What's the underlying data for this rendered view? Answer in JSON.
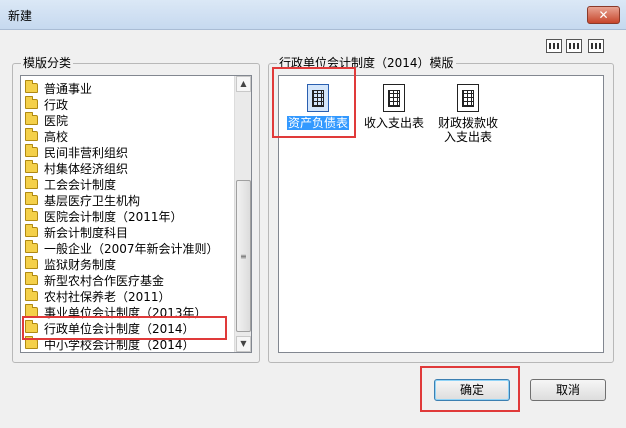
{
  "window": {
    "title": "新建",
    "close_label": "✕"
  },
  "left_group": {
    "label": "模版分类"
  },
  "right_group": {
    "label": "行政单位会计制度（2014）模版"
  },
  "categories": [
    "普通事业",
    "行政",
    "医院",
    "高校",
    "民间非营利组织",
    "村集体经济组织",
    "工会会计制度",
    "基层医疗卫生机构",
    "医院会计制度（2011年）",
    "新会计制度科目",
    "一般企业（2007年新会计准则）",
    "监狱财务制度",
    "新型农村合作医疗基金",
    "农村社保养老（2011）",
    "事业单位会计制度（2013年）",
    "行政单位会计制度（2014）",
    "中小学校会计制度（2014）"
  ],
  "selected_category": "行政单位会计制度（2014）",
  "templates": [
    {
      "label": "资产负债表",
      "selected": true
    },
    {
      "label": "收入支出表",
      "selected": false
    },
    {
      "label_line1": "财政拨款收",
      "label_line2": "入支出表",
      "selected": false
    }
  ],
  "buttons": {
    "ok": "确定",
    "cancel": "取消"
  },
  "icons": [
    "close-icon",
    "folder-icon",
    "large-icons-view-icon",
    "list-view-icon",
    "details-view-icon",
    "spreadsheet-doc-icon"
  ],
  "colors": {
    "highlight_red": "#e03a3a",
    "selection_blue": "#3399ff",
    "folder_yellow": "#f4d04a"
  }
}
